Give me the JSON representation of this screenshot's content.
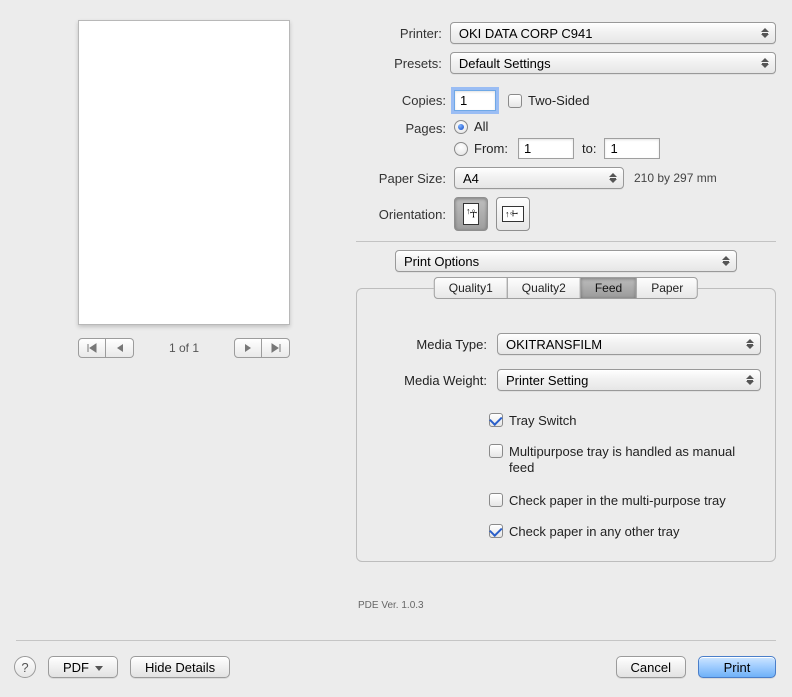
{
  "preview": {
    "page_indicator": "1 of 1"
  },
  "labels": {
    "printer": "Printer:",
    "presets": "Presets:",
    "copies": "Copies:",
    "two_sided": "Two-Sided",
    "pages": "Pages:",
    "all": "All",
    "from": "From:",
    "to": "to:",
    "paper_size": "Paper Size:",
    "orientation": "Orientation:",
    "media_type": "Media Type:",
    "media_weight": "Media Weight:"
  },
  "printer": {
    "selected": "OKI DATA CORP C941"
  },
  "presets": {
    "selected": "Default Settings"
  },
  "copies": {
    "value": "1",
    "two_sided": false
  },
  "pages": {
    "mode": "all",
    "from": "1",
    "to": "1"
  },
  "paper_size": {
    "selected": "A4",
    "dimensions": "210 by 297 mm"
  },
  "section_select": {
    "selected": "Print Options"
  },
  "tabs": [
    "Quality1",
    "Quality2",
    "Feed",
    "Paper"
  ],
  "active_tab": "Feed",
  "feed_panel": {
    "media_type": "OKITRANSFILM",
    "media_weight": "Printer Setting",
    "tray_switch": {
      "label": "Tray Switch",
      "checked": true
    },
    "mp_manual": {
      "label": "Multipurpose tray is handled as manual feed",
      "checked": false
    },
    "check_mp": {
      "label": "Check paper in the multi-purpose tray",
      "checked": false
    },
    "check_other": {
      "label": "Check paper in any other tray",
      "checked": true
    }
  },
  "pde_version": "PDE Ver. 1.0.3",
  "footer": {
    "pdf_label": "PDF",
    "hide_details": "Hide Details",
    "cancel": "Cancel",
    "print": "Print"
  }
}
